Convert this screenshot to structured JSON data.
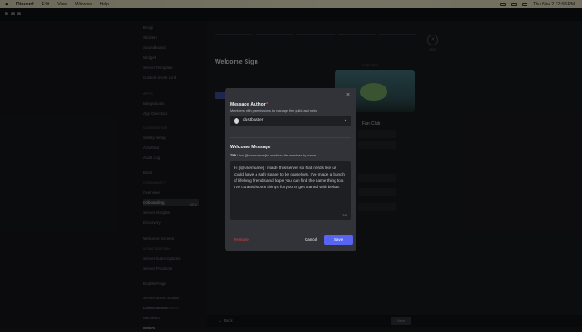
{
  "menubar": {
    "app": "Discord",
    "items": [
      "Edit",
      "View",
      "Window",
      "Help"
    ],
    "clock": "Thu Nov 2  12:06 PM"
  },
  "sidebar": {
    "items": [
      {
        "label": "Emoji"
      },
      {
        "label": "Stickers"
      },
      {
        "label": "Soundboard"
      },
      {
        "label": "Widget"
      },
      {
        "label": "Server Template"
      },
      {
        "label": "Custom Invite Link"
      },
      {
        "label": "APPS",
        "cat": true
      },
      {
        "label": "Integrations"
      },
      {
        "label": "App Directory"
      },
      {
        "label": "MODERATION",
        "cat": true
      },
      {
        "label": "Safety Setup"
      },
      {
        "label": "AutoMod"
      },
      {
        "label": "Audit Log"
      },
      {
        "label": "Bans"
      },
      {
        "label": "COMMUNITY",
        "cat": true
      },
      {
        "label": "Overview"
      },
      {
        "label": "Onboarding",
        "active": true,
        "badge": "NEW"
      },
      {
        "label": "Server Insights"
      },
      {
        "label": "Discovery"
      },
      {
        "label": "Welcome Screen"
      },
      {
        "label": "MONETIZATION",
        "cat": true
      },
      {
        "label": "Server Subscriptions"
      },
      {
        "label": "Server Products"
      },
      {
        "label": "Enable Page"
      },
      {
        "label": "Server Boost Status"
      },
      {
        "label": "USER MANAGEMENT",
        "cat": true
      },
      {
        "label": "Members"
      },
      {
        "label": "Invites"
      },
      {
        "label": "Delete Server"
      }
    ]
  },
  "main": {
    "welcome_title": "Welcome Sign",
    "esc": "ESC",
    "preview_label": "PREVIEW",
    "fan_club": "Fan Club",
    "back": "Back",
    "next": "Next"
  },
  "modal": {
    "author_label": "Message Author",
    "author_required": "*",
    "author_desc": "Members with permissions to manage the guild and roles",
    "author_name": "dustbuster",
    "message_label": "Welcome Message",
    "tip_prefix": "TIP:",
    "tip_text": "Use [@username] to mention the member by name.",
    "message_text": "Hi [@username] I made this server so that nerds like us could have a safe space to be ourselves. I've made a bunch of lifelong friends and hope you can find the same thing too. I've curated some things for you to get started with below.",
    "counter": "244",
    "remove": "Remove",
    "cancel": "Cancel",
    "save": "Save"
  }
}
